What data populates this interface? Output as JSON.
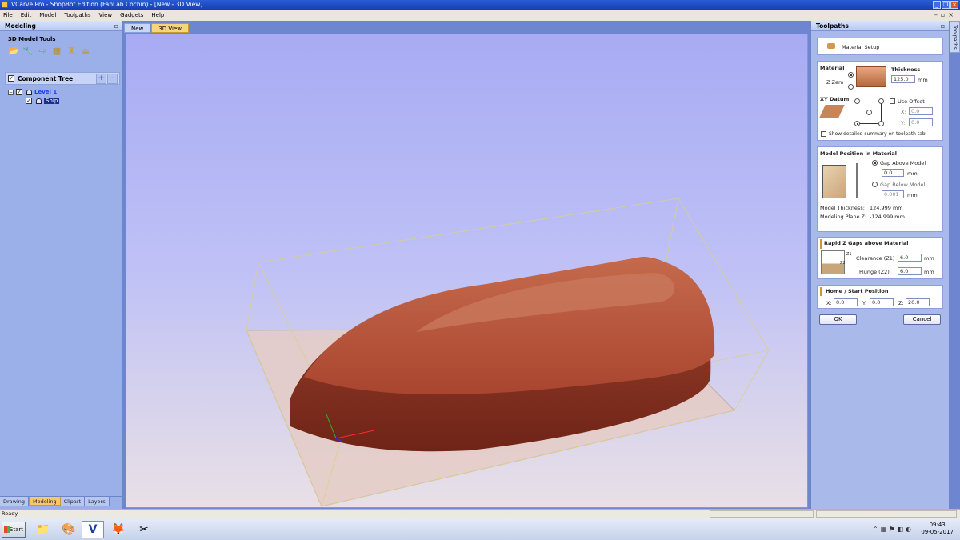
{
  "window": {
    "title": "VCarve Pro - ShopBot Edition (FabLab Cochin) - [New - 3D View]"
  },
  "menu": {
    "items": [
      "File",
      "Edit",
      "Model",
      "Toolpaths",
      "View",
      "Gadgets",
      "Help"
    ]
  },
  "left_panel": {
    "title": "Modeling",
    "tools_title": "3D Model Tools",
    "tool_icons": [
      "folder-open-icon",
      "wrench-icon",
      "arrow-right-icon",
      "grid-icon",
      "lamp-icon",
      "weight-icon"
    ],
    "component_tree_label": "Component Tree",
    "tree": {
      "level_label": "Level 1",
      "item_label": "Ship"
    },
    "tabs": [
      "Drawing",
      "Modeling",
      "Clipart",
      "Layers"
    ],
    "active_tab": "Modeling"
  },
  "doc_tabs": [
    "New",
    "3D View"
  ],
  "active_doc_tab": "3D View",
  "right_panel": {
    "title": "Toolpaths",
    "side_tab": "Toolpaths",
    "material_setup_label": "Material Setup",
    "material": {
      "title": "Material",
      "z_zero_label": "Z Zero",
      "thickness_label": "Thickness",
      "thickness_value": "125.0",
      "unit": "mm",
      "xy_datum_label": "XY Datum",
      "use_offset_label": "Use Offset",
      "x_label": "X:",
      "y_label": "Y:",
      "offset_x": "0.0",
      "offset_y": "0.0",
      "summary_label": "Show detailed summary on toolpath tab"
    },
    "model_position": {
      "title": "Model Position in Material",
      "gap_above_label": "Gap Above Model",
      "gap_above_value": "0.0",
      "gap_below_label": "Gap Below Model",
      "gap_below_value": "0.001",
      "unit": "mm",
      "model_thickness_label": "Model Thickness:",
      "model_thickness_value": "124.999 mm",
      "modeling_plane_label": "Modeling Plane Z:",
      "modeling_plane_value": "-124.999 mm"
    },
    "rapid_z": {
      "title": "Rapid Z Gaps above Material",
      "z1_tag": "Z1",
      "z2_tag": "Z2",
      "clearance_label": "Clearance (Z1)",
      "clearance_value": "6.0",
      "plunge_label": "Plunge (Z2)",
      "plunge_value": "6.0",
      "unit": "mm"
    },
    "home": {
      "title": "Home / Start Position",
      "x_label": "X:",
      "x_value": "0.0",
      "y_label": "Y:",
      "y_value": "0.0",
      "z_label": "Z:",
      "z_value": "20.0"
    },
    "ok_label": "OK",
    "cancel_label": "Cancel"
  },
  "status": {
    "text": "Ready"
  },
  "taskbar": {
    "start_label": "Start",
    "apps": [
      "explorer-icon",
      "paint-icon",
      "vcarve-icon",
      "firefox-icon",
      "snipping-tool-icon"
    ],
    "time": "09:43",
    "date": "09-05-2017"
  },
  "colors": {
    "accent": "#f8c868",
    "viewport_top": "#a8abf3",
    "model": "#b5533a"
  }
}
